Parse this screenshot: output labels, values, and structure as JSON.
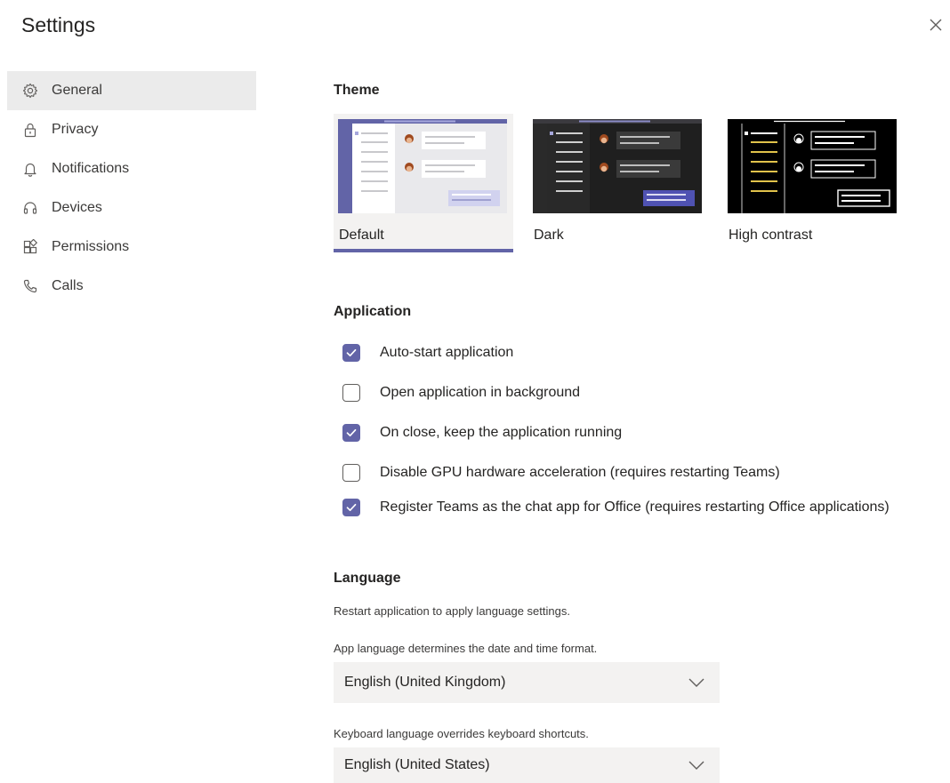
{
  "window": {
    "title": "Settings"
  },
  "sidebar": {
    "items": [
      {
        "label": "General",
        "icon": "gear-icon",
        "selected": true
      },
      {
        "label": "Privacy",
        "icon": "lock-icon",
        "selected": false
      },
      {
        "label": "Notifications",
        "icon": "bell-icon",
        "selected": false
      },
      {
        "label": "Devices",
        "icon": "headset-icon",
        "selected": false
      },
      {
        "label": "Permissions",
        "icon": "apps-icon",
        "selected": false
      },
      {
        "label": "Calls",
        "icon": "phone-icon",
        "selected": false
      }
    ]
  },
  "theme": {
    "heading": "Theme",
    "options": [
      {
        "label": "Default",
        "selected": true
      },
      {
        "label": "Dark",
        "selected": false
      },
      {
        "label": "High contrast",
        "selected": false
      }
    ]
  },
  "application": {
    "heading": "Application",
    "options": [
      {
        "label": "Auto-start application",
        "checked": true
      },
      {
        "label": "Open application in background",
        "checked": false
      },
      {
        "label": "On close, keep the application running",
        "checked": true
      },
      {
        "label": "Disable GPU hardware acceleration (requires restarting Teams)",
        "checked": false
      },
      {
        "label": "Register Teams as the chat app for Office (requires restarting Office applications)",
        "checked": true
      }
    ]
  },
  "language": {
    "heading": "Language",
    "restart_note": "Restart application to apply language settings.",
    "app_language_note": "App language determines the date and time format.",
    "app_language_value": "English (United Kingdom)",
    "keyboard_language_note": "Keyboard language overrides keyboard shortcuts.",
    "keyboard_language_value": "English (United States)"
  },
  "colors": {
    "accent": "#6264a7",
    "nav_selected_bg": "#ebebeb",
    "dropdown_bg": "#f3f2f1"
  }
}
